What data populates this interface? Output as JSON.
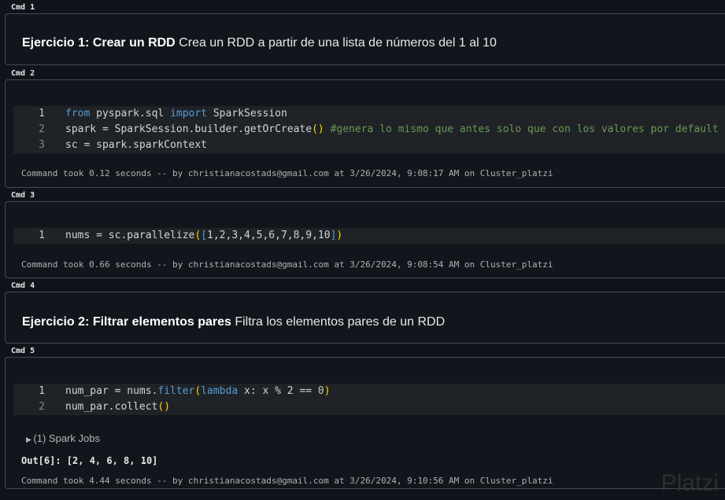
{
  "cells": [
    {
      "label": "Cmd 1",
      "bold": "Ejercicio 1: Crear un RDD",
      "text": " Crea un RDD a partir de una lista de números del 1 al 10"
    },
    {
      "label": "Cmd 2",
      "status": "Command took 0.12 seconds -- by christianacostads@gmail.com at 3/26/2024, 9:08:17 AM on Cluster_platzi"
    },
    {
      "label": "Cmd 3",
      "status": "Command took 0.66 seconds -- by christianacostads@gmail.com at 3/26/2024, 9:08:54 AM on Cluster_platzi"
    },
    {
      "label": "Cmd 4",
      "bold": "Ejercicio 2: Filtrar elementos pares",
      "text": " Filtra los elementos pares de un RDD"
    },
    {
      "label": "Cmd 5",
      "jobs": "(1) Spark Jobs",
      "output": "Out[6]: [2, 4, 6, 8, 10]",
      "status": "Command took 4.44 seconds -- by christianacostads@gmail.com at 3/26/2024, 9:10:56 AM on Cluster_platzi"
    }
  ],
  "watermark": "Platzi"
}
